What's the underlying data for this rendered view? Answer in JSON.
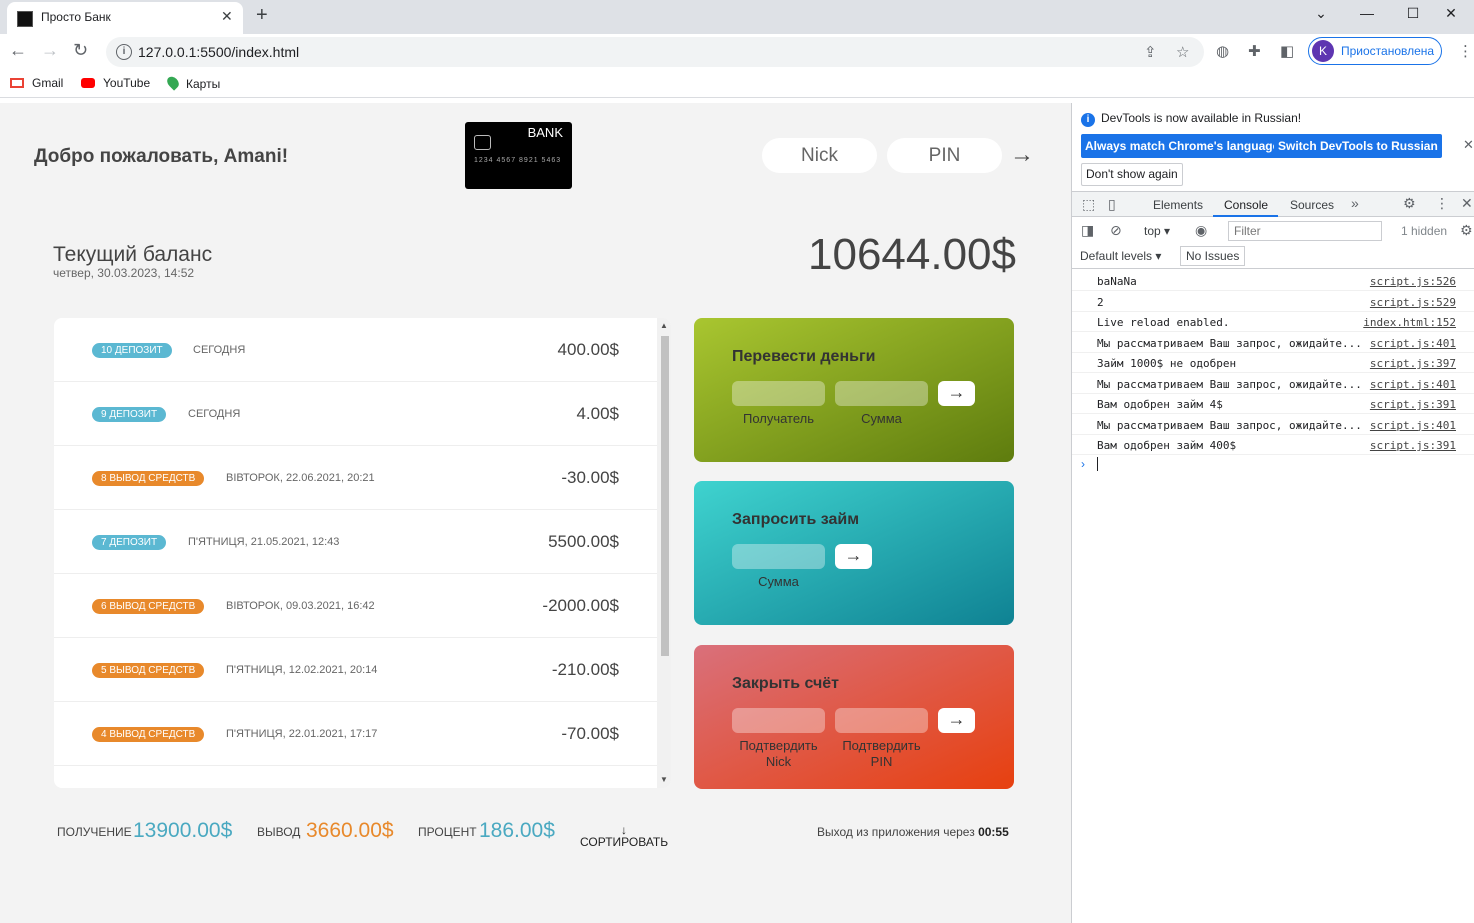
{
  "browser": {
    "tab_title": "Просто Банк",
    "url": "127.0.0.1:5500/index.html",
    "profile_initial": "K",
    "profile_status": "Приостановлена",
    "bookmarks": [
      "Gmail",
      "YouTube",
      "Карты"
    ]
  },
  "app": {
    "welcome": "Добро пожаловать, Amani!",
    "card": {
      "brand": "BANK",
      "number": "1234   4567   8921   5463"
    },
    "login": {
      "user_placeholder": "Nick",
      "pin_placeholder": "PIN",
      "button": "→"
    },
    "balance": {
      "label": "Текущий баланс",
      "date": "четвер, 30.03.2023, 14:52",
      "value": "10644.00$"
    },
    "movements": [
      {
        "type": "deposit",
        "label": "10 ДЕПОЗИТ",
        "date": "СЕГОДНЯ",
        "value": "400.00$"
      },
      {
        "type": "deposit",
        "label": "9 ДЕПОЗИТ",
        "date": "СЕГОДНЯ",
        "value": "4.00$"
      },
      {
        "type": "withdrawal",
        "label": "8 ВЫВОД СРЕДСТВ",
        "date": "ВІВТОРОК, 22.06.2021, 20:21",
        "value": "-30.00$"
      },
      {
        "type": "deposit",
        "label": "7 ДЕПОЗИТ",
        "date": "П'ЯТНИЦЯ, 21.05.2021, 12:43",
        "value": "5500.00$"
      },
      {
        "type": "withdrawal",
        "label": "6 ВЫВОД СРЕДСТВ",
        "date": "ВІВТОРОК, 09.03.2021, 16:42",
        "value": "-2000.00$"
      },
      {
        "type": "withdrawal",
        "label": "5 ВЫВОД СРЕДСТВ",
        "date": "П'ЯТНИЦЯ, 12.02.2021, 20:14",
        "value": "-210.00$"
      },
      {
        "type": "withdrawal",
        "label": "4 ВЫВОД СРЕДСТВ",
        "date": "П'ЯТНИЦЯ, 22.01.2021, 17:17",
        "value": "-70.00$"
      }
    ],
    "operations": {
      "transfer": {
        "title": "Перевести деньги",
        "to_label": "Получатель",
        "amount_label": "Сумма",
        "button": "→"
      },
      "loan": {
        "title": "Запросить займ",
        "amount_label": "Сумма",
        "button": "→"
      },
      "close": {
        "title": "Закрыть счёт",
        "user_label": "Подтвердить Nick",
        "pin_label": "Подтвердить PIN",
        "button": "→"
      }
    },
    "summary": {
      "in_label": "ПОЛУЧЕНИЕ",
      "in_value": "13900.00$",
      "out_label": "ВЫВОД",
      "out_value": "3660.00$",
      "interest_label": "ПРОЦЕНТ",
      "interest_value": "186.00$",
      "sort_arrow": "↓",
      "sort_label": "СОРТИРОВАТЬ"
    },
    "logout": {
      "text": "Выход из приложения через",
      "timer": "00:55"
    }
  },
  "devtools": {
    "info": "DevTools is now available in Russian!",
    "btn_match": "Always match Chrome's language",
    "btn_switch": "Switch DevTools to Russian",
    "btn_dont_show": "Don't show again",
    "tabs": [
      "Elements",
      "Console",
      "Sources"
    ],
    "context": "top",
    "filter_placeholder": "Filter",
    "hidden": "1 hidden",
    "levels": "Default levels",
    "issues": "No Issues",
    "logs": [
      {
        "msg": "baNaNa",
        "src": "script.js:526"
      },
      {
        "msg": "2",
        "src": "script.js:529"
      },
      {
        "msg": "Live reload enabled.",
        "src": "index.html:152"
      },
      {
        "msg": "Мы рассматриваем Ваш запрос, ожидайте...",
        "src": "script.js:401"
      },
      {
        "msg": "Займ 1000$ не одобрен",
        "src": "script.js:397"
      },
      {
        "msg": "Мы рассматриваем Ваш запрос, ожидайте...",
        "src": "script.js:401"
      },
      {
        "msg": "Вам одобрен займ 4$",
        "src": "script.js:391"
      },
      {
        "msg": "Мы рассматриваем Ваш запрос, ожидайте...",
        "src": "script.js:401"
      },
      {
        "msg": "Вам одобрен займ 400$",
        "src": "script.js:391"
      }
    ]
  }
}
